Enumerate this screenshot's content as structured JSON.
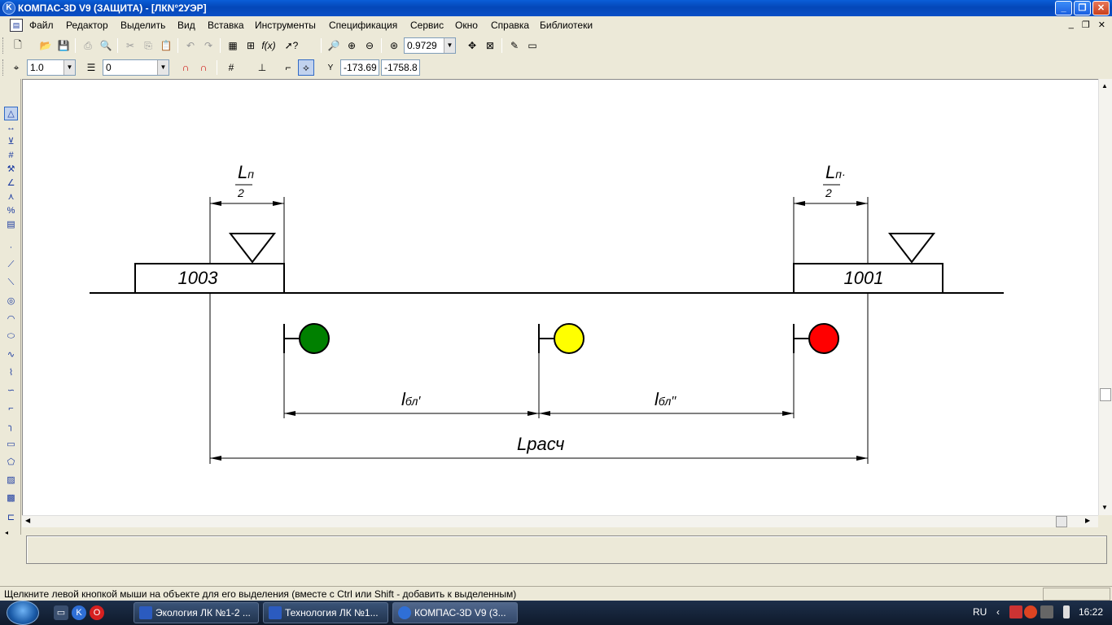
{
  "window": {
    "title": "КОМПАС-3D V9 (ЗАЩИТА) - [ЛКN°2УЭР]"
  },
  "menu": [
    "Файл",
    "Редактор",
    "Выделить",
    "Вид",
    "Вставка",
    "Инструменты",
    "Спецификация",
    "Сервис",
    "Окно",
    "Справка",
    "Библиотеки"
  ],
  "toolbar1": {
    "zoom_value": "0.9729"
  },
  "toolbar2": {
    "step_value": "1.0",
    "layer_value": "0",
    "coord_x": "-173.69",
    "coord_y": "-1758.8",
    "coord_label": "Y"
  },
  "drawing": {
    "station_left": "1003",
    "station_right": "1001",
    "dim_top_left_num": "L",
    "dim_top_left_sub": "п",
    "dim_top_left_den": "2",
    "dim_top_right_num": "L",
    "dim_top_right_sub": "п·",
    "dim_top_right_den": "2",
    "dim_bl1": "l",
    "dim_bl1_sub": "бл",
    "dim_bl1_mark": "′",
    "dim_bl2": "l",
    "dim_bl2_sub": "бл",
    "dim_bl2_mark": "′′",
    "dim_total": "Lрасч",
    "signal_colors": [
      "#008000",
      "#ffff00",
      "#ff0000"
    ]
  },
  "status": {
    "message": "Щелкните левой кнопкой мыши на объекте для его выделения (вместе с Ctrl или Shift - добавить к выделенным)"
  },
  "taskbar": {
    "tasks": [
      "Экология ЛК №1-2 ...",
      "Технология ЛК №1...",
      "КОМПАС-3D V9 (3..."
    ],
    "lang": "RU",
    "clock": "16:22"
  }
}
